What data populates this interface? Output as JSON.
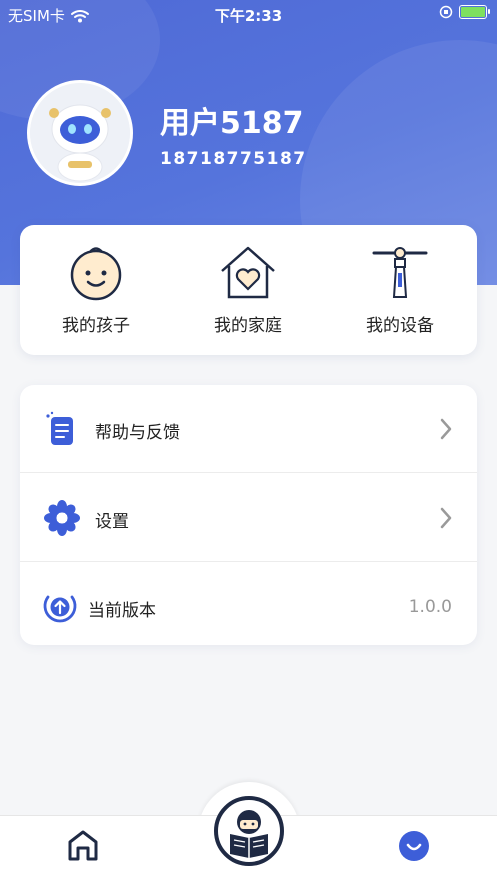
{
  "status_bar": {
    "carrier": "无SIM卡",
    "time": "下午2:33"
  },
  "profile": {
    "username": "用户5187",
    "phone": "18718775187"
  },
  "quick_actions": [
    {
      "label": "我的孩子",
      "icon": "child-face-icon"
    },
    {
      "label": "我的家庭",
      "icon": "home-heart-icon"
    },
    {
      "label": "我的设备",
      "icon": "device-lamp-icon"
    }
  ],
  "menu": {
    "help": {
      "label": "帮助与反馈",
      "icon": "document-icon"
    },
    "settings": {
      "label": "设置",
      "icon": "flower-gear-icon"
    },
    "version": {
      "label": "当前版本",
      "value": "1.0.0",
      "icon": "upload-circle-icon"
    }
  },
  "tabbar": {
    "items": [
      "home-icon",
      "reading-kid-icon",
      "smile-profile-icon"
    ]
  },
  "colors": {
    "accent": "#4f6ad6",
    "dark": "#1f2a44",
    "text": "#222222",
    "muted": "#999999"
  }
}
